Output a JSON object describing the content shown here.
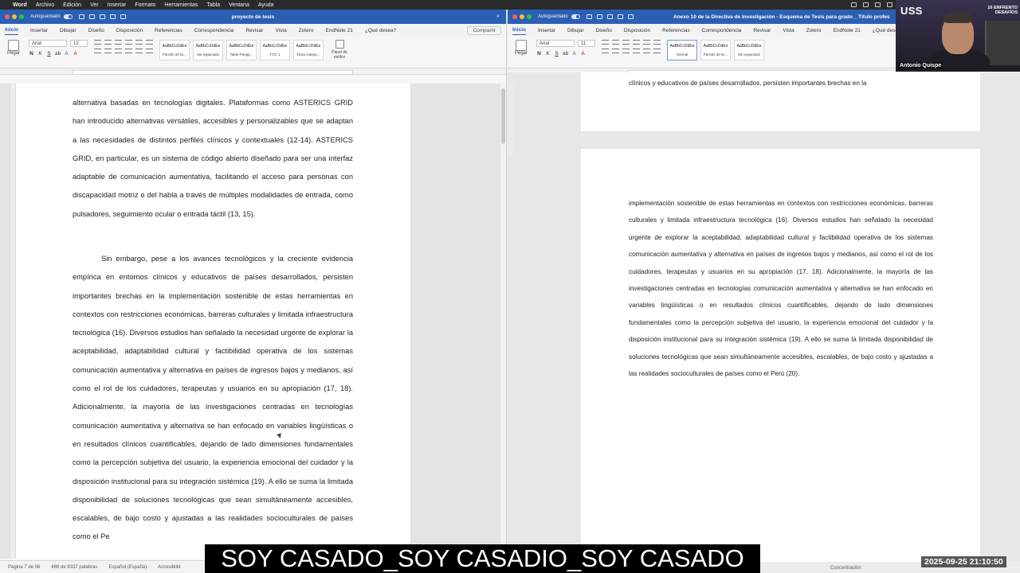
{
  "menubar": {
    "items": [
      "Word",
      "Archivo",
      "Edición",
      "Ver",
      "Insertar",
      "Formato",
      "Herramientas",
      "Tabla",
      "Ventana",
      "Ayuda"
    ]
  },
  "left_window": {
    "autosave": "Autoguardado",
    "title": "proyecto de tesis",
    "tabs": [
      "Inicio",
      "Insertar",
      "Dibujar",
      "Diseño",
      "Disposición",
      "Referencias",
      "Correspondencia",
      "Revisar",
      "Vista",
      "Zotero",
      "EndNote 21",
      "¿Qué desea?"
    ],
    "share": "Compartir",
    "ribbon": {
      "paste": "Pegar",
      "font": "Arial",
      "size": "12",
      "styles": [
        {
          "preview": "AaBbCcDdEe",
          "label": "Párrafo de lis..."
        },
        {
          "preview": "AaBbCcDdEe",
          "label": "Sin espaciado"
        },
        {
          "preview": "AaBbCcDdEe",
          "label": "Table Paragr..."
        },
        {
          "preview": "AaBbCcDdEe",
          "label": "TOC 1"
        },
        {
          "preview": "AaBbCcDdEe",
          "label": "Texto indepe..."
        }
      ],
      "panel": "Panel de estilos"
    },
    "paragraphs": [
      "alternativa basadas en tecnologías digitales. Plataformas como ASTERICS GRID han introducido alternativas versátiles, accesibles y personalizables que se adaptan a las necesidades de distintos perfiles clínicos y contextuales (12-14). ASTERICS GRID, en particular, es un sistema de código abierto diseñado para ser una interfaz adaptable de comunicación aumentativa, facilitando el acceso para personas con discapacidad motriz o del habla a través de múltiples modalidades de entrada, como pulsadores, seguimiento ocular o entrada táctil (13, 15).",
      "Sin embargo, pese a los avances tecnológicos y la creciente evidencia empírica en entornos clínicos y educativos de países desarrollados, persisten importantes brechas en la implementación sostenible de estas herramientas en contextos con restricciones económicas, barreras culturales y limitada infraestructura tecnológica (16). Diversos estudios han señalado la necesidad urgente de explorar la aceptabilidad, adaptabilidad cultural y factibilidad operativa de los sistemas comunicación aumentativa y alternativa en países de ingresos bajos y medianos, así como el rol de los cuidadores, terapeutas y usuarios en su apropiación (17, 18). Adicionalmente, la mayoría de las investigaciones centradas en tecnologías comunicación aumentativa y alternativa se han enfocado en variables lingüísticas o en resultados clínicos cuantificables, dejando de lado dimensiones fundamentales como la percepción subjetiva del usuario, la experiencia emocional del cuidador y la disposición institucional para su integración sistémica (19). A ello se suma la limitada disponibilidad de soluciones tecnológicas que sean simultáneamente accesibles, escalables, de bajo costo y ajustadas a las realidades socioculturales de países como el Pe"
    ],
    "status": {
      "page": "Página 7 de 56",
      "words": "469 de 8337 palabras",
      "language": "Español (España)",
      "accessibility": "Accesibilid"
    }
  },
  "right_window": {
    "autosave": "Autoguardado",
    "title": "Anexo 10 de la Directiva de Investigación - Esquema de Tesis para grado _ Título profes",
    "tabs": [
      "Inicio",
      "Insertar",
      "Dibujar",
      "Diseño",
      "Disposición",
      "Referencias",
      "Correspondencia",
      "Revisar",
      "Vista",
      "Zotero",
      "EndNote 21",
      "¿Qué desea"
    ],
    "ribbon": {
      "paste": "Pegar",
      "font": "Arial",
      "size": "11",
      "styles": [
        {
          "preview": "AaBbCcDdEe",
          "label": "Normal"
        },
        {
          "preview": "AaBbCcDdEe",
          "label": "Párrafo de lis..."
        },
        {
          "preview": "AaBbCcDdEe",
          "label": "Sin espaciado"
        }
      ]
    },
    "page1_text": "clínicos y educativos de países desarrollados, persisten importantes brechas en la",
    "page2_text": "implementación sostenible de estas herramientas en contextos con restricciones económicas, barreras culturales y limitada infraestructura tecnológica (16). Diversos estudios han señalado la necesidad urgente de explorar la aceptabilidad, adaptabilidad cultural y factibilidad operativa de los sistemas comunicación aumentativa y alternativa en países de ingresos bajos y medianos, así como el rol de los cuidadores, terapeutas y usuarios en su apropiación (17, 18). Adicionalmente, la mayoría de las investigaciones centradas en tecnologías comunicación aumentativa y alternativa se han enfocado en variables lingüísticas o en resultados clínicos cuantificables, dejando de lado dimensiones fundamentales como la percepción subjetiva del usuario, la experiencia emocional del cuidador y la disposición institucional para su integración sistémica (19). A ello se suma la limitada disponibilidad de soluciones tecnológicas que sean simultáneamente accesibles, escalables, de bajo costo y ajustadas a las realidades socioculturales de países como el Perú (20).",
    "status": {
      "focus": "Concentración"
    }
  },
  "webcam": {
    "logo": "USS",
    "slogan_line1": "10 ENFRENTO",
    "slogan_line2": "DESAFÍOS",
    "name": "Antonio Quispe"
  },
  "caption": "SOY CASADO_SOY CASADIO_SOY CASADO",
  "timestamp": "2025-09-25  21:10:50",
  "colors": {
    "word_blue": "#2b5fb3",
    "caption_bg": "#000000"
  }
}
